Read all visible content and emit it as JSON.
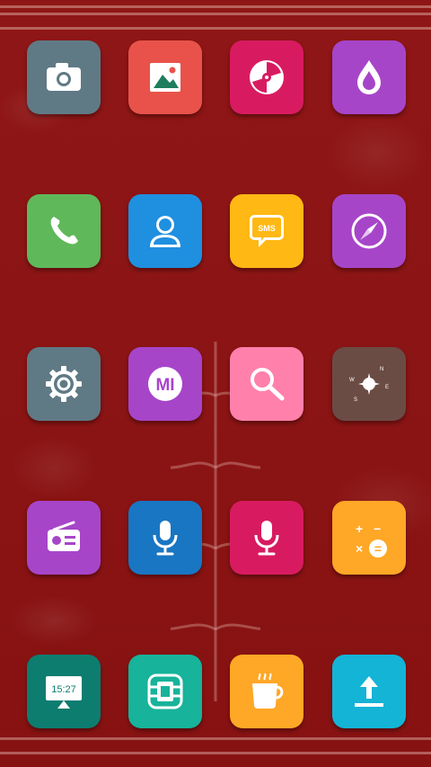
{
  "home": {
    "apps": [
      {
        "id": "camera",
        "icon": "camera-icon",
        "color": "#5f7a85"
      },
      {
        "id": "gallery",
        "icon": "gallery-icon",
        "color": "#e8524a"
      },
      {
        "id": "music",
        "icon": "disc-icon",
        "color": "#d81b60"
      },
      {
        "id": "themes",
        "icon": "droplet-icon",
        "color": "#a745c9"
      },
      {
        "id": "phone",
        "icon": "phone-icon",
        "color": "#5fb85a"
      },
      {
        "id": "contacts",
        "icon": "contact-icon",
        "color": "#1f8fe0"
      },
      {
        "id": "messaging",
        "icon": "sms-icon",
        "color": "#ffb814",
        "badge_text": "SMS"
      },
      {
        "id": "browser",
        "icon": "compass-icon",
        "color": "#a745c9"
      },
      {
        "id": "settings",
        "icon": "gear-icon",
        "color": "#5f7a85"
      },
      {
        "id": "mi-community",
        "icon": "mi-icon",
        "color": "#a745c9",
        "badge_text": "MI"
      },
      {
        "id": "search",
        "icon": "search-icon",
        "color": "#ff80ab"
      },
      {
        "id": "compass",
        "icon": "compass-rose-icon",
        "color": "#6b4c45",
        "directions": [
          "N",
          "E",
          "S",
          "W"
        ]
      },
      {
        "id": "fm-radio",
        "icon": "radio-icon",
        "color": "#a745c9"
      },
      {
        "id": "recorder",
        "icon": "microphone-icon",
        "color": "#1976c2"
      },
      {
        "id": "voice-assistant",
        "icon": "microphone-icon",
        "color": "#d81b60"
      },
      {
        "id": "calculator",
        "icon": "calculator-icon",
        "color": "#ffa726",
        "symbols": [
          "+",
          "−",
          "×",
          "="
        ]
      },
      {
        "id": "clock",
        "icon": "clock-screen-icon",
        "color": "#0d7d70",
        "time_text": "15:27"
      },
      {
        "id": "sim-toolkit",
        "icon": "sim-card-icon",
        "color": "#17b39a"
      },
      {
        "id": "app-store",
        "icon": "coffee-cup-icon",
        "color": "#ffa726"
      },
      {
        "id": "updater",
        "icon": "upload-icon",
        "color": "#14b4d6"
      }
    ]
  }
}
